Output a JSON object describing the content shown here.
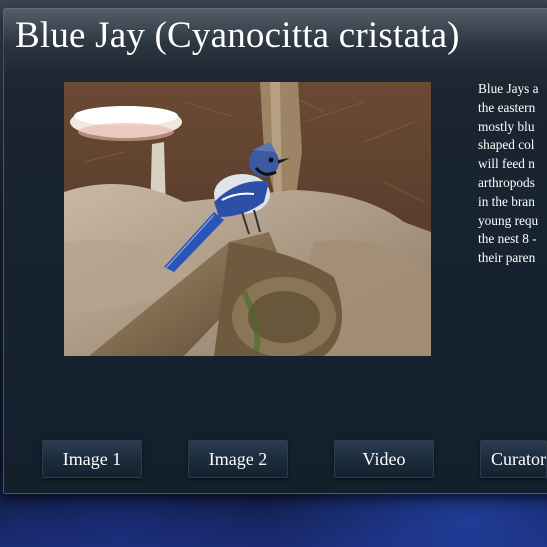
{
  "page": {
    "title": "Blue Jay (Cyanocitta cristata)"
  },
  "description": {
    "lines": [
      "Blue Jays a",
      "the eastern",
      "mostly blu",
      "shaped col",
      "will feed n",
      "arthropods",
      "in the bran",
      "young requ",
      "the nest 8 -",
      "their paren"
    ]
  },
  "buttons": {
    "image1": "Image 1",
    "image2": "Image 2",
    "video": "Video",
    "curator": "Curator"
  }
}
